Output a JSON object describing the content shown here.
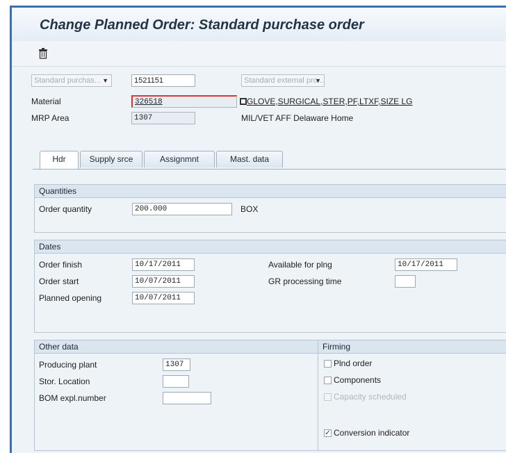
{
  "window": {
    "title": "Change Planned Order: Standard purchase order"
  },
  "toolbar": {
    "icon": "trash-icon"
  },
  "header": {
    "order_type": "Standard purchas...",
    "order_number": "1521151",
    "procurement_type": "Standard external pro...",
    "material_label": "Material",
    "material_value": "326518",
    "material_desc": "GLOVE,SURGICAL,STER,PF,LTXF,SIZE LG",
    "mrp_area_label": "MRP Area",
    "mrp_area_value": "1307",
    "mrp_area_desc": "MIL/VET AFF Delaware Home"
  },
  "tabs": [
    {
      "label": "Hdr"
    },
    {
      "label": "Supply srce"
    },
    {
      "label": "Assignmnt"
    },
    {
      "label": "Mast. data"
    }
  ],
  "quantities": {
    "title": "Quantities",
    "order_qty_label": "Order quantity",
    "order_qty_value": "200.000",
    "unit": "BOX"
  },
  "dates": {
    "title": "Dates",
    "order_finish_label": "Order finish",
    "order_finish_value": "10/17/2011",
    "order_start_label": "Order start",
    "order_start_value": "10/07/2011",
    "planned_opening_label": "Planned opening",
    "planned_opening_value": "10/07/2011",
    "available_label": "Available for plng",
    "available_value": "10/17/2011",
    "gr_label": "GR processing time",
    "gr_value": ""
  },
  "other_data": {
    "title": "Other data",
    "plant_label": "Producing plant",
    "plant_value": "1307",
    "stor_label": "Stor. Location",
    "stor_value": "",
    "bom_label": "BOM expl.number",
    "bom_value": ""
  },
  "firming": {
    "title": "Firming",
    "plnd_order": "Plnd order",
    "components": "Components",
    "capacity": "Capacity scheduled",
    "conversion": "Conversion indicator"
  }
}
